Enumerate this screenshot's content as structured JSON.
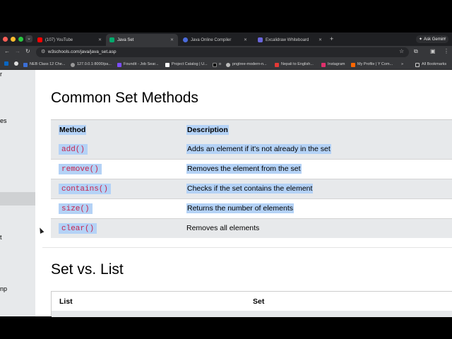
{
  "browser": {
    "tabs": [
      {
        "label": "(107) YouTube",
        "favicon": "youtube-icon",
        "color": "#ff0000"
      },
      {
        "label": "Java Set",
        "favicon": "w3schools-icon",
        "color": "#04aa6d"
      },
      {
        "label": "Java Online Compiler",
        "favicon": "compiler-icon",
        "color": "#4b6bdc"
      },
      {
        "label": "Excalidraw Whiteboard",
        "favicon": "excalidraw-icon",
        "color": "#6965db"
      }
    ],
    "ask_gemini": "Ask Gemini",
    "url": "w3schools.com/java/java_set.asp",
    "bookmarks": [
      "NEB Class 12 Che...",
      "127.0.0.1:8000/pa...",
      "Foundit - Job Sear...",
      "Project Catalog | U...",
      "o",
      "pngtree-modern-n...",
      "Nepali to English...",
      "Instagram",
      "My Profile | Y Com...",
      "All Bookmarks"
    ]
  },
  "sidebar": {
    "fragments": [
      "r",
      "es",
      "t",
      "np"
    ]
  },
  "content": {
    "heading_methods": "Common Set Methods",
    "methods_table": {
      "headers": [
        "Method",
        "Description"
      ],
      "rows": [
        {
          "method": "add()",
          "description": "Adds an element if it's not already in the set"
        },
        {
          "method": "remove()",
          "description": "Removes the element from the set"
        },
        {
          "method": "contains()",
          "description": "Checks if the set contains the element"
        },
        {
          "method": "size()",
          "description": "Returns the number of elements"
        },
        {
          "method": "clear()",
          "description": "Removes all elements"
        }
      ]
    },
    "heading_vs": "Set vs. List",
    "vs_table": {
      "headers": [
        "List",
        "Set"
      ]
    }
  },
  "colors": {
    "selection": "#b4d2f6",
    "code_text": "#c7254e",
    "row_shade": "#e7e9eb",
    "sidebar_bg": "#e7e9eb"
  }
}
